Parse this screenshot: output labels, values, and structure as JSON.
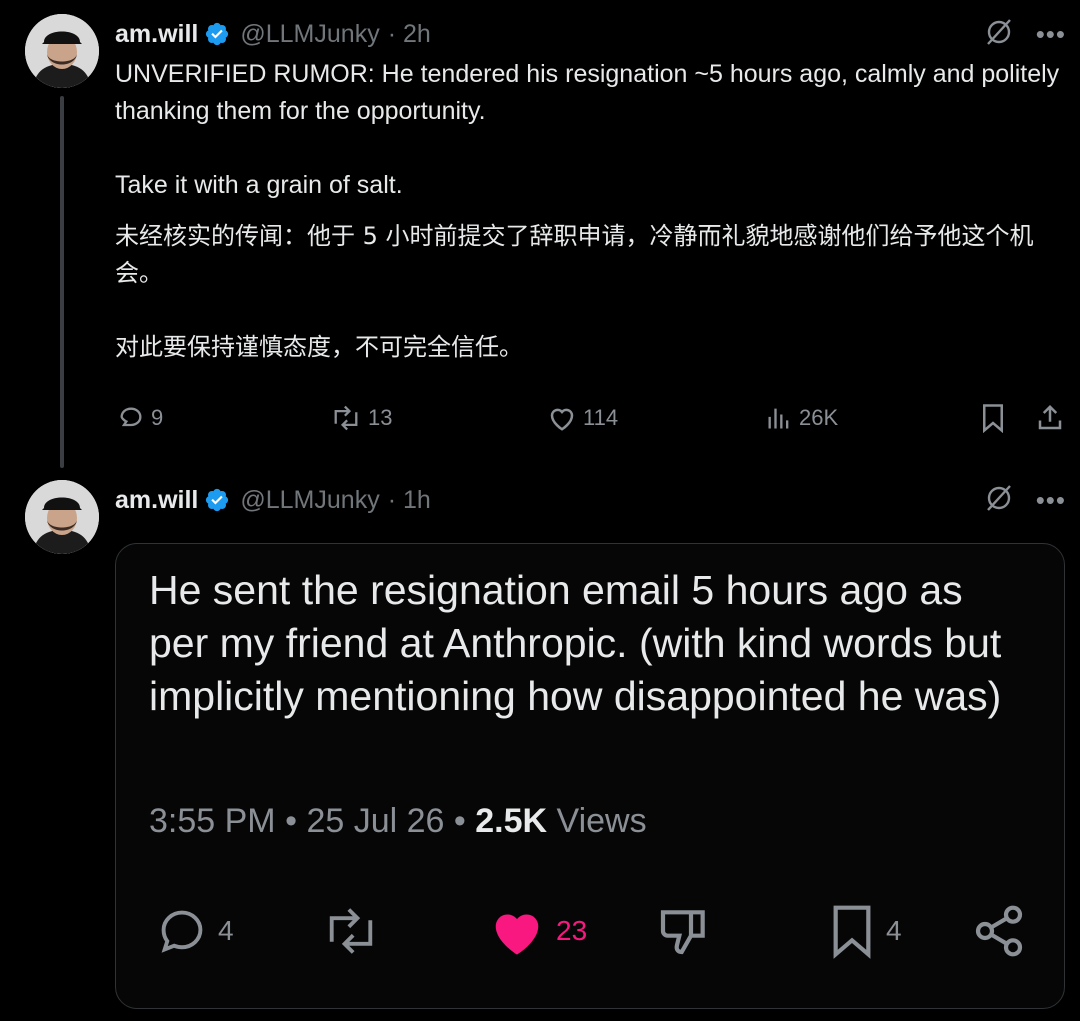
{
  "tweets": [
    {
      "author": "am.will",
      "handle": "@LLMJunky",
      "time": "· 2h",
      "paragraphs_en": [
        "UNVERIFIED RUMOR: He tendered his resignation ~5 hours ago, calmly and politely thanking them for the opportunity.",
        "Take it with a grain of salt."
      ],
      "paragraphs_zh": [
        "未经核实的传闻：他于 5 小时前提交了辞职申请，冷静而礼貌地感谢他们给予他这个机会。",
        "对此要保持谨慎态度，不可完全信任。"
      ],
      "actions": {
        "replies": "9",
        "reposts": "13",
        "likes": "114",
        "views": "26K"
      }
    },
    {
      "author": "am.will",
      "handle": "@LLMJunky",
      "time": "· 1h",
      "card": {
        "text": "He sent the resignation email 5 hours ago as per my friend at Anthropic. (with kind words but implicitly mentioning how disappointed he was)",
        "time": "3:55 PM",
        "date": "25 Jul 26",
        "views_count": "2.5K",
        "views_label": "Views",
        "actions": {
          "replies": "4",
          "likes": "23",
          "bookmarks": "4"
        }
      }
    }
  ],
  "colors": {
    "background": "#000000",
    "text": "#e7e9ea",
    "muted": "#71767b",
    "verified": "#1d9bf0",
    "like": "#f91880"
  },
  "icons": [
    "grok-icon",
    "more-icon",
    "reply-icon",
    "repost-icon",
    "like-icon",
    "views-icon",
    "bookmark-icon",
    "share-icon",
    "dislike-icon"
  ]
}
